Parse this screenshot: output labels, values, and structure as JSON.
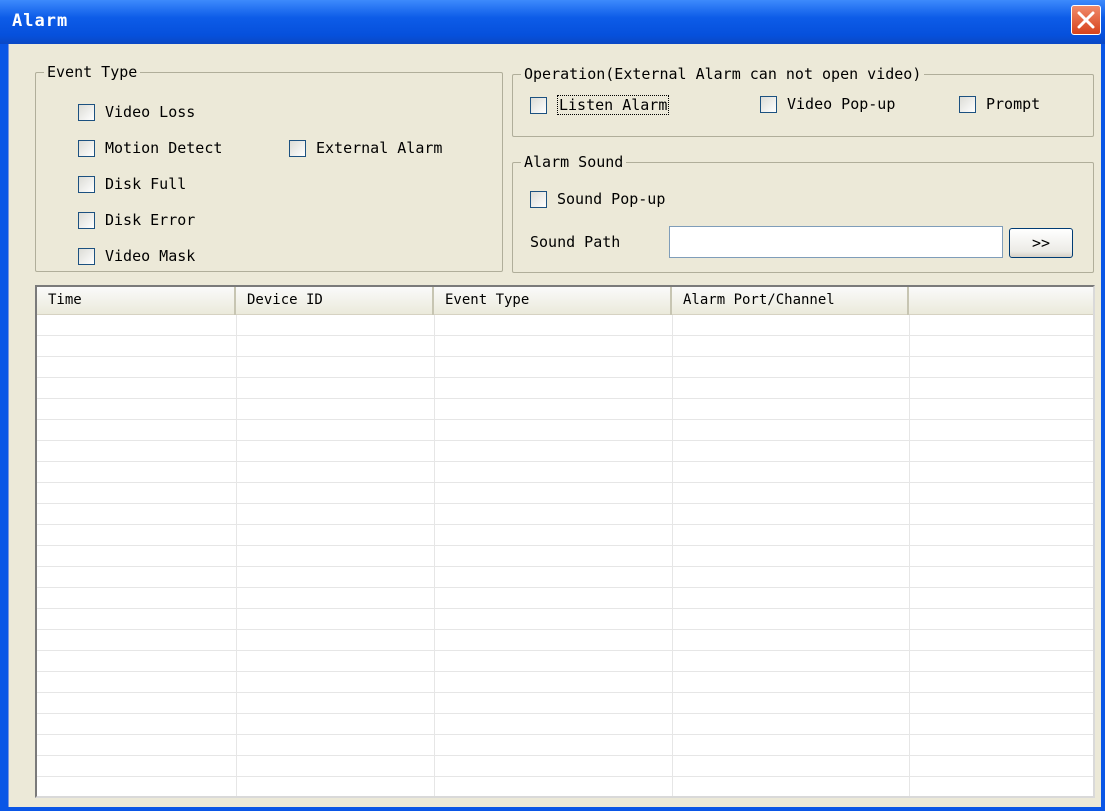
{
  "window": {
    "title": "Alarm"
  },
  "event_type": {
    "legend": "Event Type",
    "items": [
      {
        "label": "Video Loss",
        "checked": false
      },
      {
        "label": "Motion Detect",
        "checked": false
      },
      {
        "label": "External Alarm",
        "checked": false
      },
      {
        "label": "Disk Full",
        "checked": false
      },
      {
        "label": "Disk Error",
        "checked": false
      },
      {
        "label": "Video Mask",
        "checked": false
      }
    ]
  },
  "operation": {
    "legend": "Operation(External Alarm can not open video)",
    "items": [
      {
        "label": "Listen Alarm",
        "checked": false
      },
      {
        "label": "Video Pop-up",
        "checked": false
      },
      {
        "label": "Prompt",
        "checked": false
      }
    ]
  },
  "alarm_sound": {
    "legend": "Alarm Sound",
    "sound_popup": {
      "label": "Sound Pop-up",
      "checked": false
    },
    "sound_path_label": "Sound Path",
    "sound_path_value": "",
    "browse_label": ">>"
  },
  "table": {
    "columns": [
      "Time",
      "Device ID",
      "Event Type",
      "Alarm Port/Channel",
      ""
    ],
    "rows": []
  },
  "icons": {
    "close": "close-icon"
  },
  "colors": {
    "titlebar": "#0a56e6",
    "client": "#ece9d8",
    "close": "#d7421c"
  }
}
